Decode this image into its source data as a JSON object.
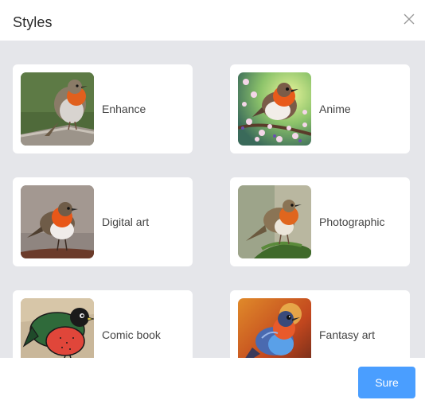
{
  "dialog": {
    "title": "Styles",
    "close_icon": "close-icon",
    "confirm_label": "Sure",
    "accent_color": "#4a9eff"
  },
  "styles": [
    {
      "label": "Enhance",
      "icon": "robin-photo-thumbnail"
    },
    {
      "label": "Anime",
      "icon": "robin-anime-thumbnail"
    },
    {
      "label": "Digital art",
      "icon": "robin-digital-art-thumbnail"
    },
    {
      "label": "Photographic",
      "icon": "robin-photographic-thumbnail"
    },
    {
      "label": "Comic book",
      "icon": "robin-comic-thumbnail"
    },
    {
      "label": "Fantasy art",
      "icon": "robin-fantasy-thumbnail"
    }
  ]
}
